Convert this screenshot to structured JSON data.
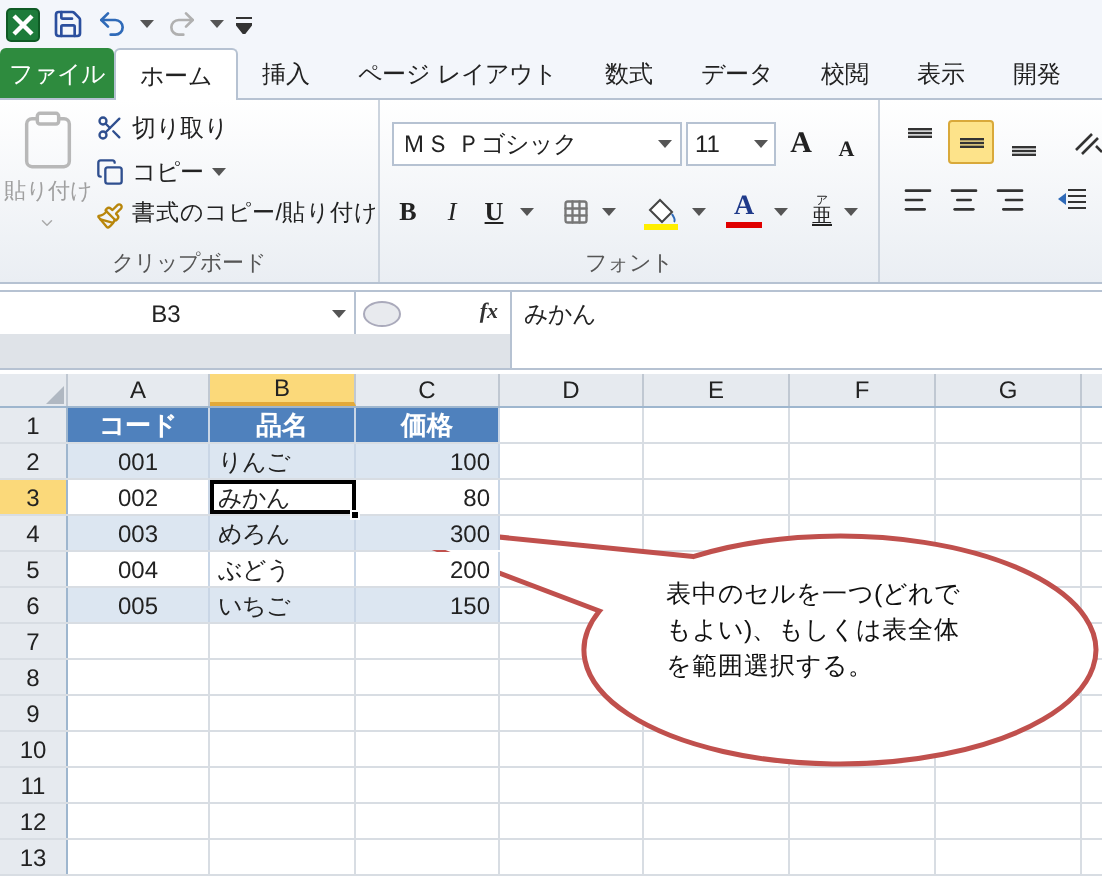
{
  "ribbon_tabs": [
    {
      "label": "ファイル",
      "kind": "file",
      "selected": false
    },
    {
      "label": "ホーム",
      "kind": "tab",
      "selected": true
    },
    {
      "label": "挿入",
      "kind": "tab",
      "selected": false
    },
    {
      "label": "ページ レイアウト",
      "kind": "tab",
      "selected": false
    },
    {
      "label": "数式",
      "kind": "tab",
      "selected": false
    },
    {
      "label": "データ",
      "kind": "tab",
      "selected": false
    },
    {
      "label": "校閲",
      "kind": "tab",
      "selected": false
    },
    {
      "label": "表示",
      "kind": "tab",
      "selected": false
    },
    {
      "label": "開発",
      "kind": "tab",
      "selected": false
    }
  ],
  "clipboard": {
    "paste": {
      "label": "貼り付け",
      "disabled": true
    },
    "cut": "切り取り",
    "copy": "コピー",
    "format_painter": "書式のコピー/貼り付け",
    "group_label": "クリップボード"
  },
  "font": {
    "name": "ＭＳ Ｐゴシック",
    "size": "11",
    "grow": "A",
    "shrink": "A",
    "bold": "B",
    "italic": "I",
    "underline": "U",
    "font_color": "A",
    "phonetic_top": "ア",
    "phonetic": "亜",
    "group_label": "フォント"
  },
  "vertical_align": [
    {
      "selected": false
    },
    {
      "selected": true
    },
    {
      "selected": false
    }
  ],
  "formula_bar": {
    "name_box": "B3",
    "fx": "fx",
    "value": "みかん"
  },
  "sheet": {
    "columns": [
      {
        "label": "A",
        "selected": false
      },
      {
        "label": "B",
        "selected": true
      },
      {
        "label": "C",
        "selected": false
      },
      {
        "label": "D",
        "selected": false
      },
      {
        "label": "E",
        "selected": false
      },
      {
        "label": "F",
        "selected": false
      },
      {
        "label": "G",
        "selected": false
      }
    ],
    "row_headers": [
      {
        "label": "1",
        "selected": false
      },
      {
        "label": "2",
        "selected": false
      },
      {
        "label": "3",
        "selected": true
      },
      {
        "label": "4",
        "selected": false
      },
      {
        "label": "5",
        "selected": false
      },
      {
        "label": "6",
        "selected": false
      },
      {
        "label": "7",
        "selected": false
      },
      {
        "label": "8",
        "selected": false
      },
      {
        "label": "9",
        "selected": false
      },
      {
        "label": "10",
        "selected": false
      },
      {
        "label": "11",
        "selected": false
      },
      {
        "label": "12",
        "selected": false
      },
      {
        "label": "13",
        "selected": false
      }
    ],
    "table_header": [
      "コード",
      "品名",
      "価格"
    ],
    "table_rows": [
      {
        "cells": [
          {
            "text": "001",
            "selected": false
          },
          {
            "text": "りんご",
            "selected": false
          },
          {
            "text": "100",
            "selected": false
          }
        ]
      },
      {
        "cells": [
          {
            "text": "002",
            "selected": false
          },
          {
            "text": "みかん",
            "selected": true
          },
          {
            "text": "80",
            "selected": false
          }
        ]
      },
      {
        "cells": [
          {
            "text": "003",
            "selected": false
          },
          {
            "text": "めろん",
            "selected": false
          },
          {
            "text": "300",
            "selected": false
          }
        ]
      },
      {
        "cells": [
          {
            "text": "004",
            "selected": false
          },
          {
            "text": "ぶどう",
            "selected": false
          },
          {
            "text": "200",
            "selected": false
          }
        ]
      },
      {
        "cells": [
          {
            "text": "005",
            "selected": false
          },
          {
            "text": "いちご",
            "selected": false
          },
          {
            "text": "150",
            "selected": false
          }
        ]
      }
    ]
  },
  "callout": "表中のセルを一つ(どれでもよい)、もしくは表全体を範囲選択する。"
}
